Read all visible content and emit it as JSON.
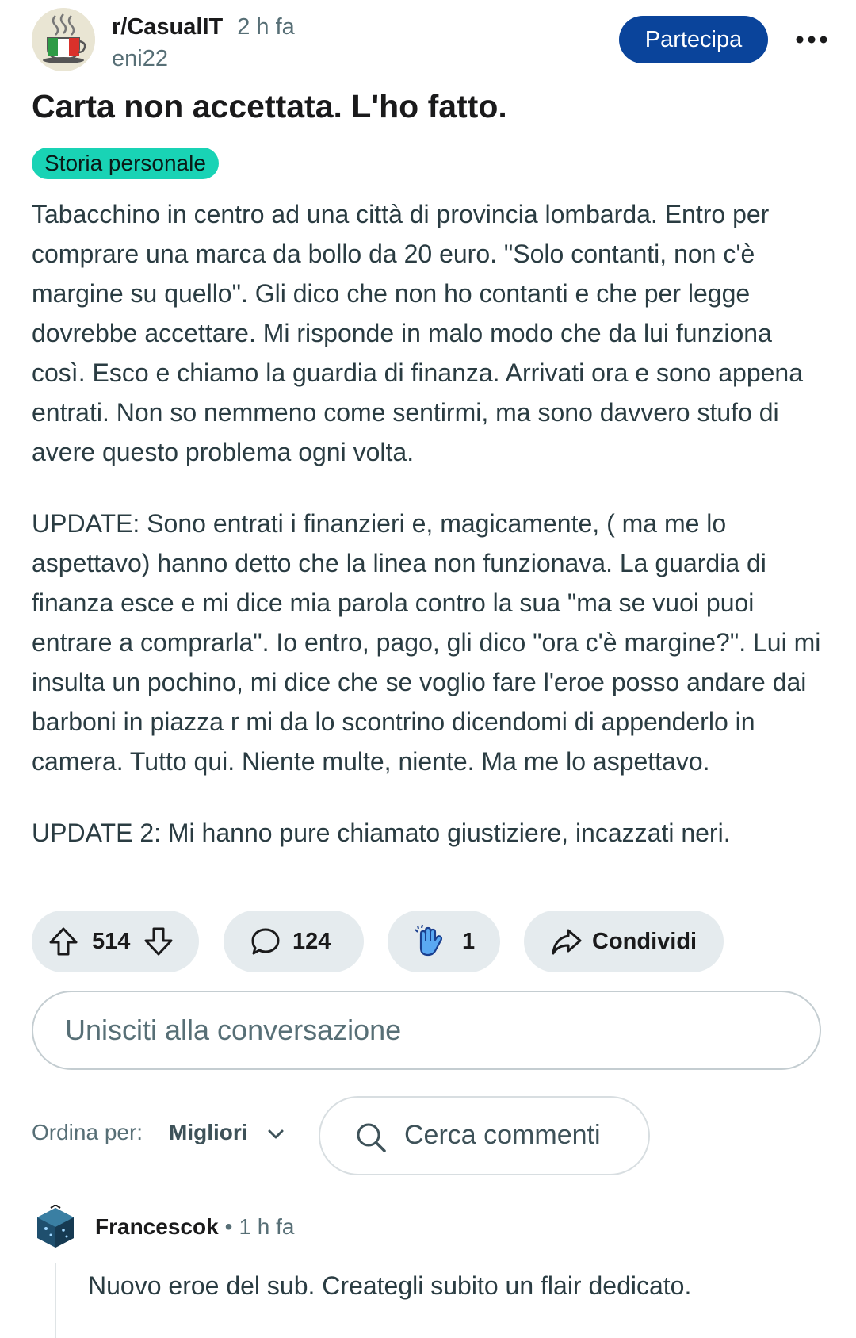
{
  "post": {
    "subreddit": "r/CasualIT",
    "time": "2 h fa",
    "author": "eni22",
    "join_label": "Partecipa",
    "more_label": "•••",
    "title": "Carta non accettata. L'ho fatto.",
    "flair": "Storia personale",
    "flair_color": "#19d3b5",
    "body": [
      "Tabacchino in centro ad una città di provincia lombarda. Entro per comprare una marca da bollo da 20 euro. \"Solo contanti, non c'è margine su quello\". Gli dico che non ho contanti e che per legge dovrebbe accettare. Mi risponde in malo modo che da lui funziona così. Esco e chiamo la guardia di finanza. Arrivati ora e sono appena entrati. Non so nemmeno come sentirmi, ma sono davvero stufo di avere questo problema ogni volta.",
      "UPDATE: Sono entrati i finanzieri e, magicamente, ( ma me lo aspettavo) hanno detto che la linea non funzionava. La guardia di finanza esce e mi dice mia parola contro la sua \"ma se vuoi puoi entrare a comprarla\". Io entro, pago, gli dico \"ora c'è margine?\". Lui mi insulta un pochino, mi dice che se voglio fare l'eroe posso andare dai barboni in piazza r mi da lo scontrino dicendomi di appenderlo in camera. Tutto qui. Niente multe, niente. Ma me lo aspettavo.",
      "UPDATE 2: Mi hanno pure chiamato giustiziere, incazzati neri."
    ]
  },
  "actions": {
    "votes": "514",
    "comments": "124",
    "awards": "1",
    "share_label": "Condividi"
  },
  "comment_input": {
    "placeholder": "Unisciti alla conversazione"
  },
  "sort": {
    "label": "Ordina per:",
    "value": "Migliori",
    "search_label": "Cerca commenti"
  },
  "comment": {
    "author": "Francescok",
    "separator": "•",
    "time": "1 h fa",
    "body": "Nuovo eroe del sub. Creategli subito un flair dedicato."
  },
  "colors": {
    "join_button": "#0a449b",
    "pill_background": "#e5ebee",
    "text_secondary": "#576f76"
  }
}
